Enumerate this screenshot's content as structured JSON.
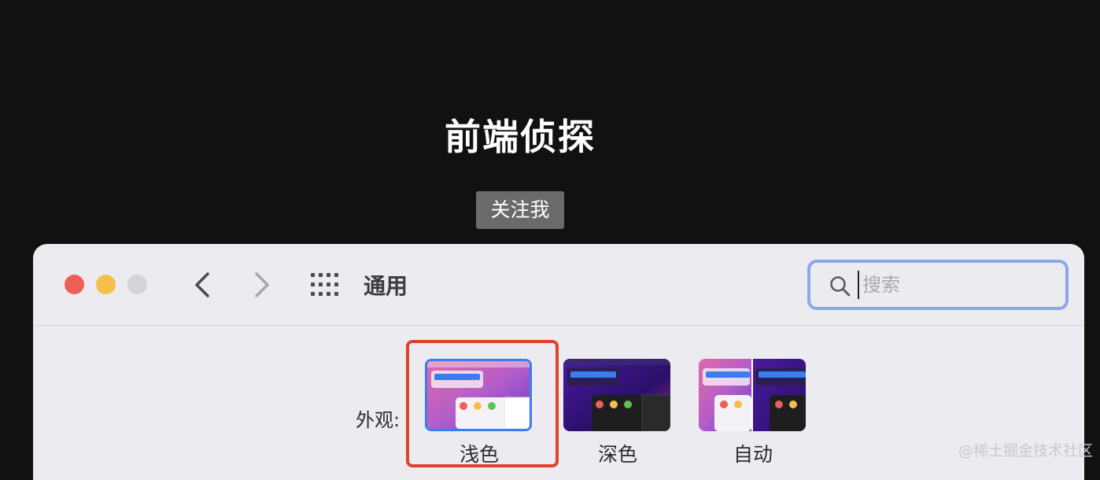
{
  "header": {
    "title": "前端侦探",
    "follow_label": "关注我"
  },
  "window": {
    "section_title": "通用",
    "search": {
      "placeholder": "搜索",
      "value": ""
    }
  },
  "appearance": {
    "label": "外观:",
    "options": [
      {
        "label": "浅色",
        "selected": true
      },
      {
        "label": "深色",
        "selected": false
      },
      {
        "label": "自动",
        "selected": false
      }
    ]
  },
  "watermark": "@稀土掘金技术社区",
  "colors": {
    "background": "#111112",
    "window": "#ecebef",
    "selection": "#3a7df0",
    "highlight": "#e0402c",
    "search_focus": "#8aa7ec"
  },
  "icons": [
    "chevron-left-icon",
    "chevron-right-icon",
    "grid-icon",
    "search-icon"
  ]
}
